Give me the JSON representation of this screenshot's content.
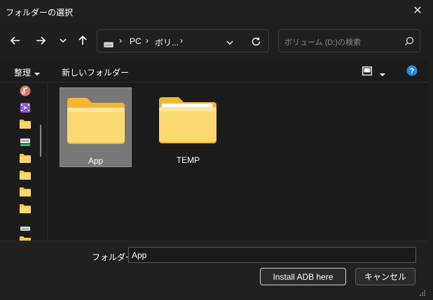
{
  "window": {
    "title": "フォルダーの選択"
  },
  "nav": {
    "breadcrumbs": [
      "PC",
      "ボリ..."
    ],
    "search_placeholder": "ボリューム (D:)の検索"
  },
  "toolbar": {
    "organize_label": "整理",
    "new_folder_label": "新しいフォルダー"
  },
  "folders": [
    {
      "name": "App",
      "selected": true
    },
    {
      "name": "TEMP",
      "selected": false
    }
  ],
  "sidebar_icons": [
    "music-icon",
    "video-icon",
    "folder-icon",
    "drive-icon",
    "folder-icon",
    "folder-icon",
    "folder-icon",
    "folder-icon",
    "drive-icon",
    "folder-icon"
  ],
  "footer": {
    "folder_label": "フォルダー:",
    "folder_value": "App",
    "install_button": "Install ADB here",
    "cancel_button": "キャンセル"
  },
  "colors": {
    "folder_yellow": "#f9c93f",
    "folder_light": "#fbe08a",
    "help_blue": "#1f8be0",
    "selection": "#777777"
  }
}
